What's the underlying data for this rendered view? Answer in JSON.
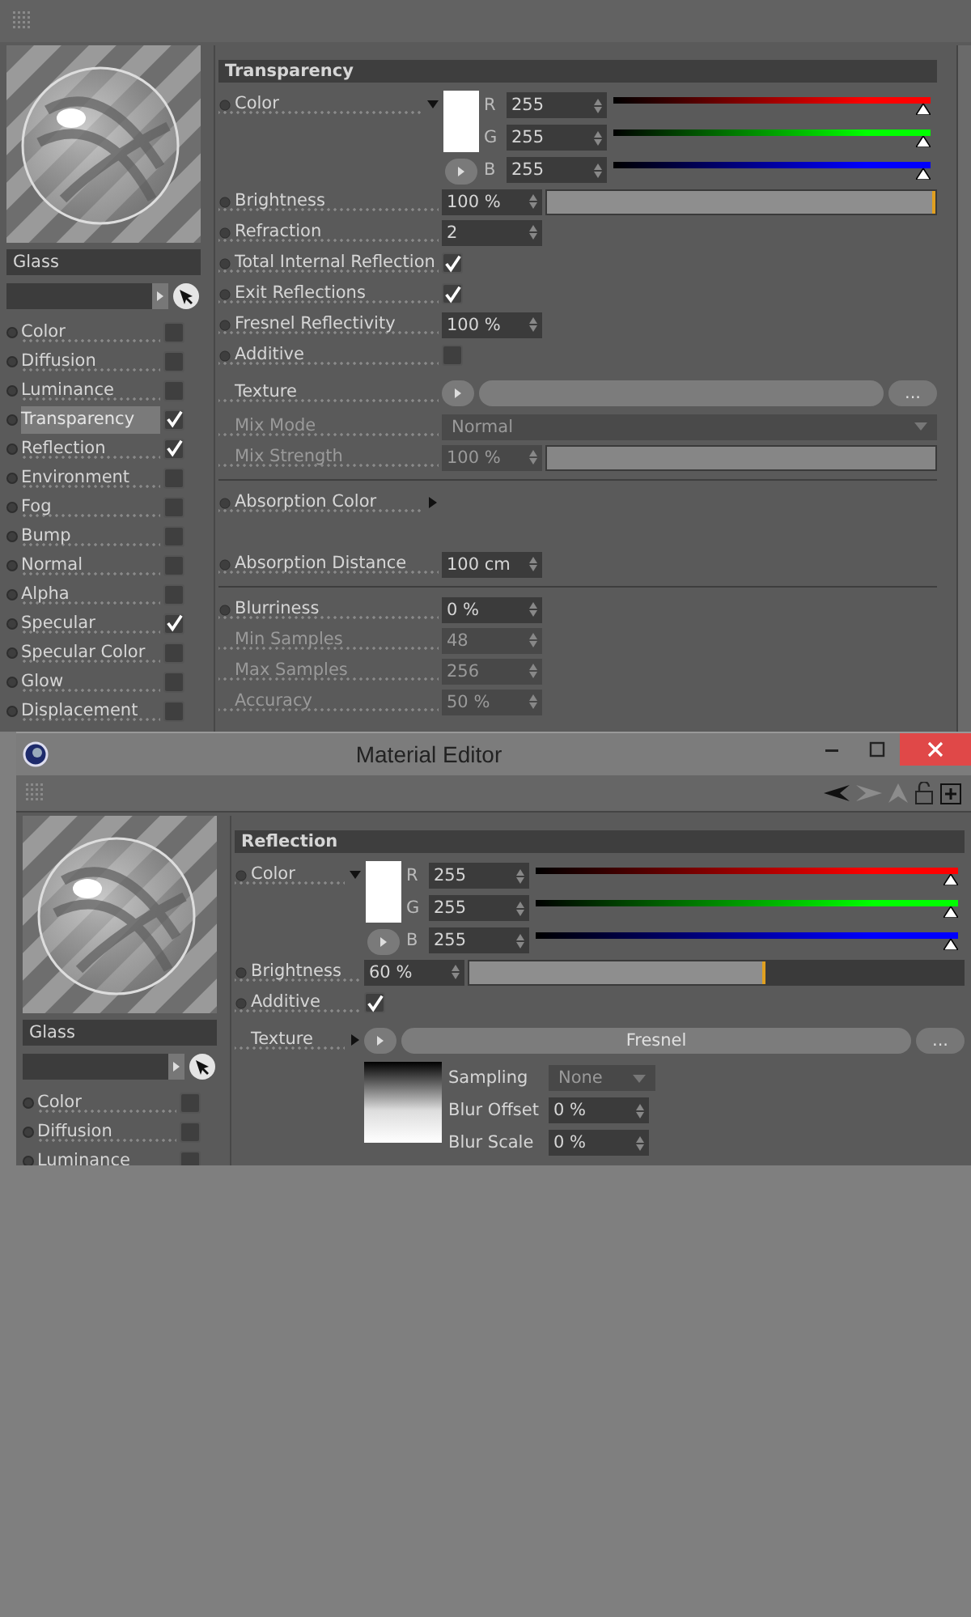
{
  "views": [
    {
      "kind": "panel",
      "material_name": "Glass",
      "section": "Transparency",
      "channels": [
        {
          "label": "Color",
          "checked": false,
          "selected": false
        },
        {
          "label": "Diffusion",
          "checked": false,
          "selected": false
        },
        {
          "label": "Luminance",
          "checked": false,
          "selected": false
        },
        {
          "label": "Transparency",
          "checked": true,
          "selected": true
        },
        {
          "label": "Reflection",
          "checked": true,
          "selected": false
        },
        {
          "label": "Environment",
          "checked": false,
          "selected": false
        },
        {
          "label": "Fog",
          "checked": false,
          "selected": false
        },
        {
          "label": "Bump",
          "checked": false,
          "selected": false
        },
        {
          "label": "Normal",
          "checked": false,
          "selected": false
        },
        {
          "label": "Alpha",
          "checked": false,
          "selected": false
        },
        {
          "label": "Specular",
          "checked": true,
          "selected": false
        },
        {
          "label": "Specular Color",
          "checked": false,
          "selected": false
        },
        {
          "label": "Glow",
          "checked": false,
          "selected": false
        },
        {
          "label": "Displacement",
          "checked": false,
          "selected": false
        }
      ],
      "groups": [
        {
          "params": [
            {
              "kind": "color",
              "label": "Color",
              "animatable": true,
              "disabled": false,
              "channels": [
                {
                  "name": "R",
                  "value": "255",
                  "level": 1,
                  "color": "#ff0000"
                },
                {
                  "name": "G",
                  "value": "255",
                  "level": 1,
                  "color": "#00ff00"
                },
                {
                  "name": "B",
                  "value": "255",
                  "level": 1,
                  "color": "#0000ff"
                }
              ]
            },
            {
              "kind": "slider",
              "label": "Brightness",
              "animatable": true,
              "disabled": false,
              "value": "100 %",
              "level": 1
            },
            {
              "kind": "number",
              "label": "Refraction",
              "animatable": true,
              "disabled": false,
              "value": "2"
            },
            {
              "kind": "checkbox",
              "label": "Total Internal Reflection",
              "animatable": true,
              "disabled": false,
              "checked": true
            },
            {
              "kind": "checkbox",
              "label": "Exit Reflections",
              "animatable": true,
              "disabled": false,
              "checked": true
            },
            {
              "kind": "number",
              "label": "Fresnel Reflectivity",
              "animatable": true,
              "disabled": false,
              "value": "100 %"
            },
            {
              "kind": "checkbox",
              "label": "Additive",
              "animatable": true,
              "disabled": false,
              "checked": false
            },
            {
              "kind": "texture",
              "label": "Texture",
              "animatable": false,
              "disabled": false,
              "more": "..."
            },
            {
              "kind": "dropdown",
              "label": "Mix Mode",
              "animatable": false,
              "disabled": true,
              "value": "Normal"
            },
            {
              "kind": "slider",
              "label": "Mix Strength",
              "animatable": false,
              "disabled": true,
              "value": "100 %",
              "level": 1
            }
          ]
        },
        {
          "params": [
            {
              "kind": "swatch",
              "label": "Absorption Color",
              "animatable": true,
              "disabled": false
            },
            {
              "kind": "number",
              "label": "Absorption Distance",
              "animatable": true,
              "disabled": false,
              "value": "100 cm"
            }
          ]
        },
        {
          "params": [
            {
              "kind": "number",
              "label": "Blurriness",
              "animatable": true,
              "disabled": false,
              "value": "0 %"
            },
            {
              "kind": "number",
              "label": "Min Samples",
              "animatable": false,
              "disabled": true,
              "value": "48"
            },
            {
              "kind": "number",
              "label": "Max Samples",
              "animatable": false,
              "disabled": true,
              "value": "256"
            },
            {
              "kind": "number",
              "label": "Accuracy",
              "animatable": false,
              "disabled": true,
              "value": "50 %"
            }
          ]
        }
      ]
    },
    {
      "kind": "window",
      "title": "Material Editor",
      "material_name": "Glass",
      "section": "Reflection",
      "channels": [
        {
          "label": "Color",
          "checked": false,
          "selected": false
        },
        {
          "label": "Diffusion",
          "checked": false,
          "selected": false
        },
        {
          "label": "Luminance",
          "checked": false,
          "selected": false
        }
      ],
      "groups": [
        {
          "params": [
            {
              "kind": "color",
              "label": "Color",
              "animatable": true,
              "disabled": false,
              "channels": [
                {
                  "name": "R",
                  "value": "255",
                  "level": 1,
                  "color": "#ff0000"
                },
                {
                  "name": "G",
                  "value": "255",
                  "level": 1,
                  "color": "#00ff00"
                },
                {
                  "name": "B",
                  "value": "255",
                  "level": 1,
                  "color": "#0000ff"
                }
              ]
            },
            {
              "kind": "slider",
              "label": "Brightness",
              "animatable": true,
              "disabled": false,
              "value": "60 %",
              "level": 0.6
            },
            {
              "kind": "checkbox",
              "label": "Additive",
              "animatable": true,
              "disabled": false,
              "checked": true
            },
            {
              "kind": "texture",
              "label": "Texture",
              "animatable": false,
              "disabled": false,
              "button": "Fresnel",
              "more": "...",
              "sub_params": [
                {
                  "kind": "dropdown",
                  "label": "Sampling",
                  "disabled": true,
                  "value": "None"
                },
                {
                  "kind": "number",
                  "label": "Blur Offset",
                  "disabled": false,
                  "value": "0 %"
                },
                {
                  "kind": "number",
                  "label": "Blur Scale",
                  "disabled": false,
                  "value": "0 %"
                }
              ]
            }
          ]
        }
      ]
    }
  ]
}
